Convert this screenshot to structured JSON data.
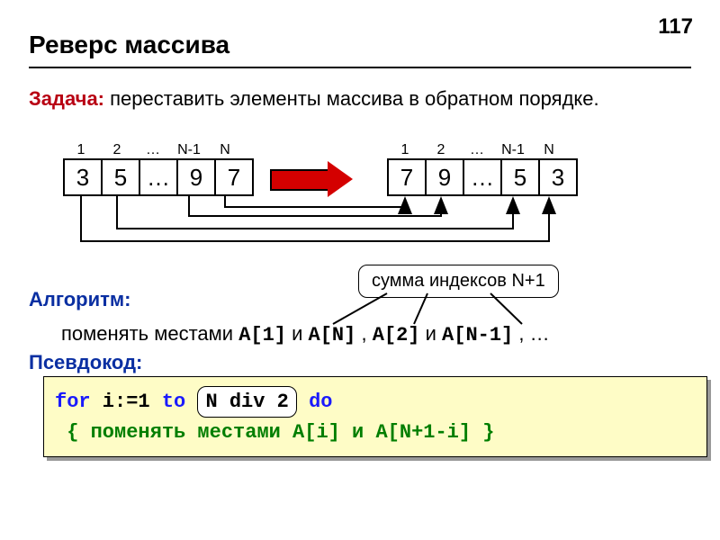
{
  "page_number": "117",
  "title": "Реверс массива",
  "task": {
    "label": "Задача:",
    "text": " переставить элементы массива в обратном порядке."
  },
  "array_headers": [
    "1",
    "2",
    "…",
    "N-1",
    "N"
  ],
  "array_before": [
    "3",
    "5",
    "…",
    "9",
    "7"
  ],
  "array_after": [
    "7",
    "9",
    "…",
    "5",
    "3"
  ],
  "callout": "сумма индексов N+1",
  "algo": {
    "label": "Алгоритм:",
    "prefix": "поменять местами ",
    "a1": "A[1]",
    "and1": " и ",
    "an": "A[N]",
    "c1": ", ",
    "a2": "A[2]",
    "and2": " и ",
    "an1": "A[N-1]",
    "tail": ", …"
  },
  "pseudo": {
    "label": "Псевдокод:",
    "kw_for": "for",
    "iexpr": " i:=1 ",
    "kw_to": "to",
    "highlight": "N div 2",
    "kw_do": "do",
    "comment": "{ поменять местами A[i] и A[N+1-i] }"
  }
}
